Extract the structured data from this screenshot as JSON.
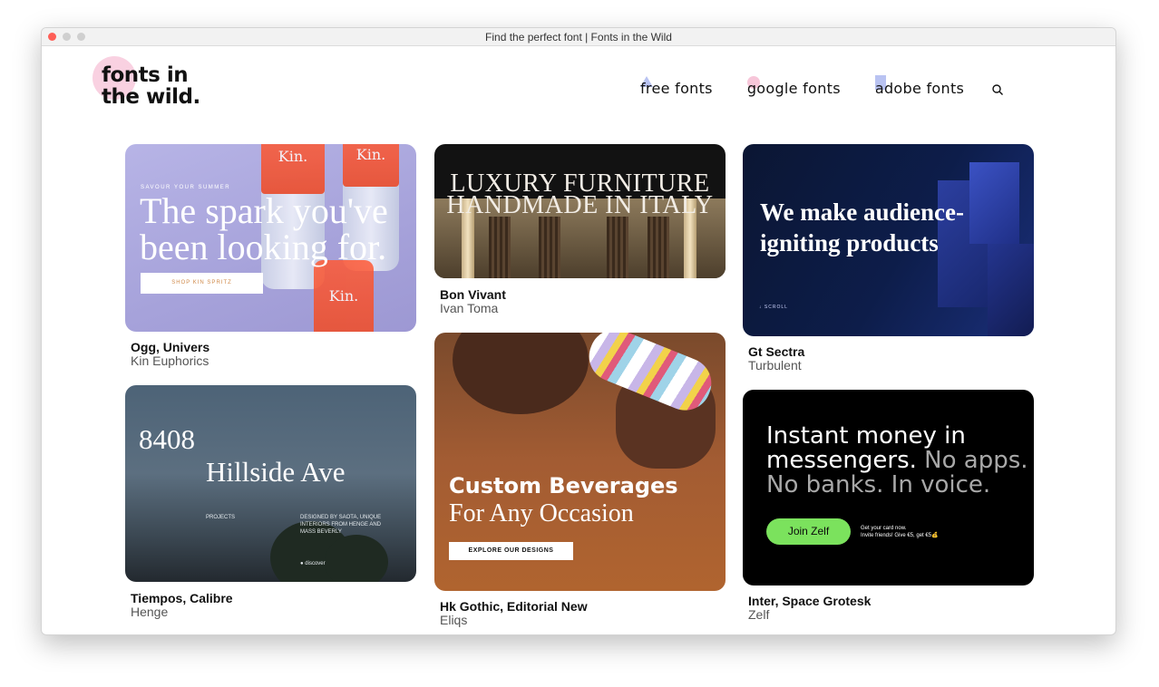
{
  "window": {
    "title": "Find the perfect font | Fonts in the Wild"
  },
  "logo": {
    "text": "fonts in\nthe wild."
  },
  "nav": {
    "items": [
      {
        "label": "free fonts"
      },
      {
        "label": "google fonts"
      },
      {
        "label": "adobe fonts"
      }
    ],
    "search_icon": "search-icon"
  },
  "colors": {
    "pink_accent": "#f7c6d9",
    "blue_accent": "#b9c3f2",
    "zelf_green": "#7be25d"
  },
  "cards": [
    {
      "fonts": "Ogg, Univers",
      "site": "Kin Euphorics",
      "preview": {
        "kicker": "SAVOUR YOUR SUMMER",
        "headline": "The spark you've\nbeen looking for.",
        "cta": "SHOP KIN SPRITZ",
        "can_label": "Kin."
      }
    },
    {
      "fonts": "Bon Vivant",
      "site": "Ivan Toma",
      "preview": {
        "headline": "LUXURY FURNITURE\nHANDMADE IN ITALY"
      }
    },
    {
      "fonts": "Gt Sectra",
      "site": "Turbulent",
      "preview": {
        "headline": "We make audience-\nigniting products",
        "scroll": "↓ SCROLL"
      }
    },
    {
      "fonts": "Tiempos, Calibre",
      "site": "Henge",
      "preview": {
        "number": "8408",
        "street": "Hillside Ave",
        "projects": "PROJECTS",
        "credit": "DESIGNED BY SAOTA, UNIQUE\nINTERIORS FROM HENGE AND\nMASS BEVERLY",
        "discover": "● discover"
      }
    },
    {
      "fonts": "Hk Gothic, Editorial New",
      "site": "Eliqs",
      "preview": {
        "headline1": "Custom Beverages",
        "headline2": "For Any Occasion",
        "cta": "EXPLORE OUR DESIGNS"
      }
    },
    {
      "fonts": "Inter, Space Grotesk",
      "site": "Zelf",
      "preview": {
        "line1": "Instant money in",
        "line2a": "messengers.",
        "line2b": " No apps.",
        "line3": "No banks. In voice.",
        "cta": "Join Zelf",
        "note": "Get your card now.\nInvite friends! Give €5, get €5💰"
      }
    }
  ]
}
